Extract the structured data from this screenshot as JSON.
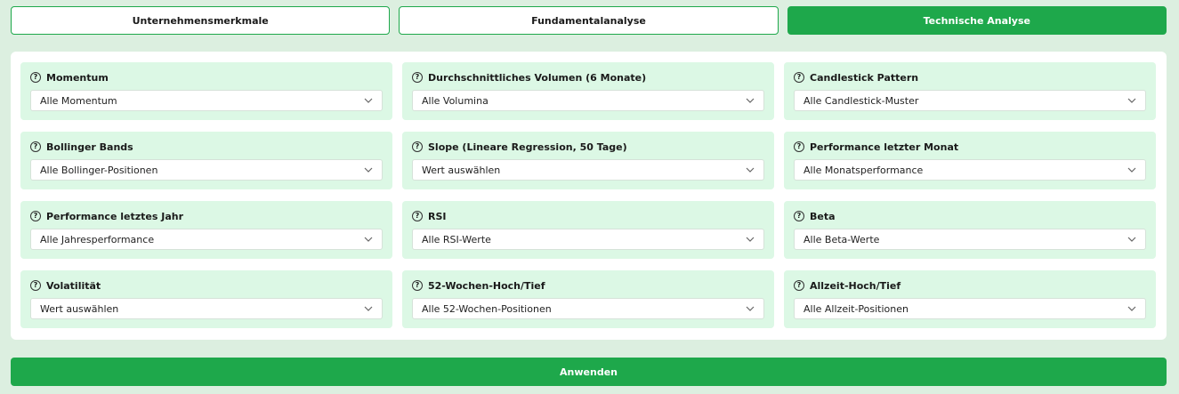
{
  "tabs": [
    {
      "label": "Unternehmensmerkmale",
      "active": false
    },
    {
      "label": "Fundamentalanalyse",
      "active": false
    },
    {
      "label": "Technische Analyse",
      "active": true
    }
  ],
  "filters": [
    {
      "label": "Momentum",
      "value": "Alle Momentum"
    },
    {
      "label": "Durchschnittliches Volumen (6 Monate)",
      "value": "Alle Volumina"
    },
    {
      "label": "Candlestick Pattern",
      "value": "Alle Candlestick-Muster"
    },
    {
      "label": "Bollinger Bands",
      "value": "Alle Bollinger-Positionen"
    },
    {
      "label": "Slope (Lineare Regression, 50 Tage)",
      "value": "Wert auswählen"
    },
    {
      "label": "Performance letzter Monat",
      "value": "Alle Monatsperformance"
    },
    {
      "label": "Performance letztes Jahr",
      "value": "Alle Jahresperformance"
    },
    {
      "label": "RSI",
      "value": "Alle RSI-Werte"
    },
    {
      "label": "Beta",
      "value": "Alle Beta-Werte"
    },
    {
      "label": "Volatilität",
      "value": "Wert auswählen"
    },
    {
      "label": "52-Wochen-Hoch/Tief",
      "value": "Alle 52-Wochen-Positionen"
    },
    {
      "label": "Allzeit-Hoch/Tief",
      "value": "Alle Allzeit-Positionen"
    }
  ],
  "help_icon_glyph": "?",
  "apply_label": "Anwenden",
  "colors": {
    "accent": "#1ea84b",
    "card_bg": "#dcf8e5",
    "page_bg": "#dcefe0"
  },
  "icons": {
    "help": "help-circle-icon",
    "dropdown": "chevron-down-icon"
  }
}
